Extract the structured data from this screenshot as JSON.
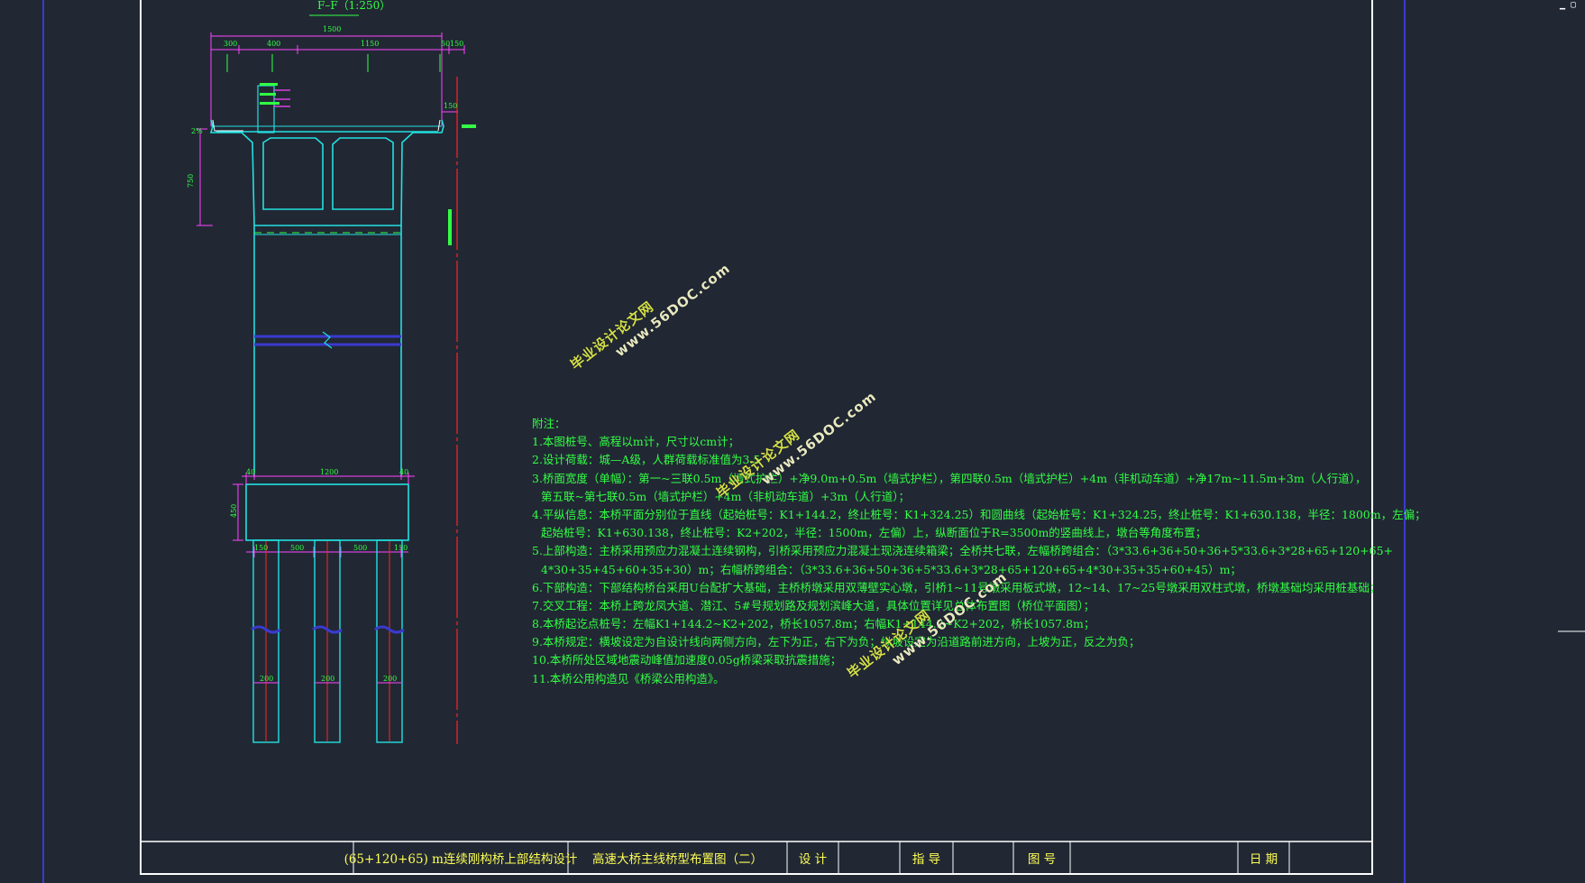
{
  "section_title": "F–F（1:250）",
  "dimensions": {
    "top_total": "1500",
    "top_segments": [
      "300",
      "400",
      "1150",
      "50",
      "150"
    ],
    "cap_width": "1200",
    "cap_sides": [
      "40",
      "40"
    ],
    "cap_height": "450",
    "pile_spacing": [
      "150",
      "500",
      "500",
      "150"
    ],
    "pile_diameters": [
      "200",
      "200",
      "200"
    ],
    "girder_depth": "750",
    "deck_edge": "150",
    "small_left": "2%"
  },
  "notes": {
    "heading": "附注：",
    "lines": [
      "1.本图桩号、高程以m计，尺寸以cm计；",
      "2.设计荷载：城—A级，人群荷载标准值为3.5",
      "3.桥面宽度（单幅）：第一~三联0.5m（墙式护栏）+净9.0m+0.5m（墙式护栏），第四联0.5m（墙式护栏）+4m（非机动车道）+净17m~11.5m+3m（人行道），",
      "第五联~第七联0.5m（墙式护栏）+4m（非机动车道）+3m（人行道）；",
      "4.平纵信息：本桥平面分别位于直线（起始桩号：K1+144.2，终止桩号：K1+324.25）和圆曲线（起始桩号：K1+324.25，终止桩号：K1+630.138，半径：1800m，左偏；",
      "起始桩号：K1+630.138，终止桩号：K2+202，半径：1500m，左偏）上，纵断面位于R=3500m的竖曲线上，墩台等角度布置；",
      "5.上部构造：主桥采用预应力混凝土连续钢构，引桥采用预应力混凝土现浇连续箱梁；全桥共七联，左幅桥跨组合：（3*33.6+36+50+36+5*33.6+3*28+65+120+65+",
      "4*30+35+45+60+35+30）m；右幅桥跨组合：（3*33.6+36+50+36+5*33.6+3*28+65+120+65+4*30+35+35+60+45）m；",
      "6.下部构造：下部结构桥台采用U台配扩大基础，主桥桥墩采用双薄壁实心墩，引桥1~11号墩采用板式墩，12~14、17~25号墩采用双柱式墩，桥墩基础均采用桩基础；",
      "7.交叉工程：本桥上跨龙凤大道、潜江、5#号规划路及规划滨峰大道，具体位置详见总体布置图（桥位平面图）；",
      "8.本桥起讫点桩号：左幅K1+144.2~K2+202，桥长1057.8m；右幅K1+144.2~K2+202，桥长1057.8m；",
      "9.本桥规定：横坡设定为自设计线向两侧方向，左下为正，右下为负；纵坡设定为沿道路前进方向，上坡为正，反之为负；",
      "10.本桥所处区域地震动峰值加速度0.05g桥梁采取抗震措施；",
      "11.本桥公用构造见《桥梁公用构造》。"
    ]
  },
  "watermarks": [
    {
      "line1": "毕业设计论文网",
      "line2": "www.56DOC.com"
    },
    {
      "line1": "毕业设计论文网",
      "line2": "www.56DOC.com"
    },
    {
      "line1": "毕业设计论文网",
      "line2": "www.56DOC.com"
    }
  ],
  "title_block": {
    "project": "(65+120+65) m连续刚构桥上部结构设计",
    "drawing": "高速大桥主线桥型布置图（二）",
    "design_label": "设  计",
    "guide_label": "指  导",
    "figno_label": "图  号",
    "date_label": "日  期"
  },
  "colors": {
    "background": "#212834",
    "frame": "#ffffff",
    "structure": "#22e0e0",
    "dimension": "#ff44ff",
    "centerline": "#ff2222",
    "text": "#33ff44",
    "title": "#ffff55",
    "border_blue": "#3a3ad0"
  }
}
